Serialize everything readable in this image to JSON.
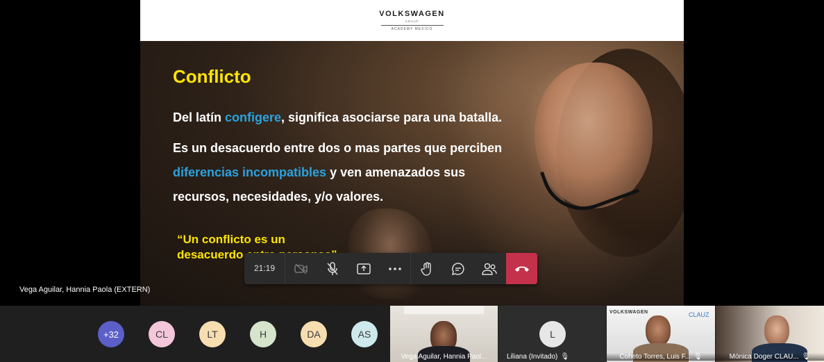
{
  "slide": {
    "brand": "VOLKSWAGEN",
    "brand_sub": "GROUP",
    "academy": "ACADEMY MEXICO",
    "title": "Conflicto",
    "line1_pre": "Del latín ",
    "line1_hl": "configere",
    "line1_post": ", significa asociarse para una batalla.",
    "line2": "Es un desacuerdo entre dos o mas partes que perciben",
    "line3_hl": "diferencias incompatibles",
    "line3_post": " y ven amenazados sus",
    "line4": "recursos, necesidades, y/o valores.",
    "quote_line1": "“Un conflicto es un",
    "quote_line2": "desacuerdo entre personas”"
  },
  "presenter": {
    "name": "Vega Aguilar, Hannia Paola (EXTERN)"
  },
  "toolbar": {
    "timer": "21:19"
  },
  "participants": {
    "overflow": "+32",
    "avatars": [
      {
        "initials": "CL",
        "color": "#f3c6d9"
      },
      {
        "initials": "LT",
        "color": "#f6deb0"
      },
      {
        "initials": "H",
        "color": "#d6e4cc"
      },
      {
        "initials": "DA",
        "color": "#f6deb0"
      },
      {
        "initials": "AS",
        "color": "#cde9ec"
      }
    ],
    "tiles": [
      {
        "name": "Vega Aguilar, Hannia Paol..."
      },
      {
        "name": "Liliana (Invitado)",
        "initial": "L"
      },
      {
        "name": "Coheto Torres, Luis F...",
        "brand": "VOLKSWAGEN",
        "brand2": "CLAUZ"
      },
      {
        "name": "Mónica Doger CLAU..."
      }
    ]
  }
}
